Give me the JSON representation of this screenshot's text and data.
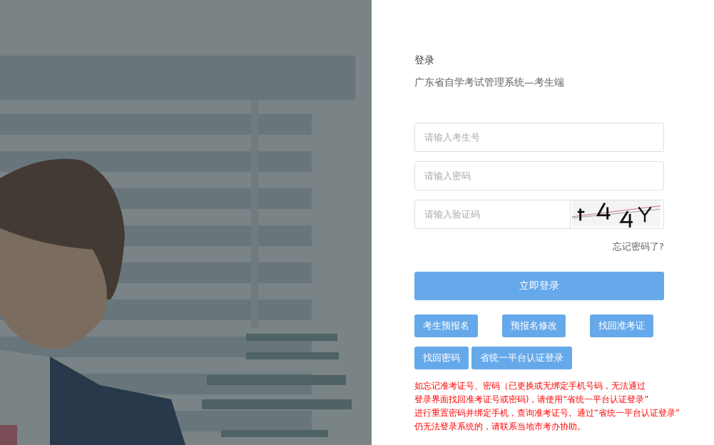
{
  "login": {
    "title": "登录",
    "subtitle": "广东省自学考试管理系统—考生端",
    "fields": [
      {
        "kind": "text",
        "placeholder": "请输入考生号"
      },
      {
        "kind": "password",
        "placeholder": "请输入密码"
      },
      {
        "kind": "captcha",
        "placeholder": "请输入验证码"
      }
    ],
    "forgot_link": "忘记密码了?",
    "submit": "立即登录",
    "button_rows": [
      [
        "考生预报名",
        "预报名修改",
        "找回准考证"
      ],
      [
        "找回密码",
        "省统一平台认证登录"
      ]
    ],
    "notice": [
      "如忘记准考证号、密码（已更换或无绑定手机号码，无法通过",
      "登录界面找回准考证号或密码)，请使用“省统一平台认证登录”",
      "进行重置密码并绑定手机，查询准考证号。通过“省统一平台认证登录”",
      "仍无法登录系统的，请联系当地市考办协助。"
    ]
  }
}
